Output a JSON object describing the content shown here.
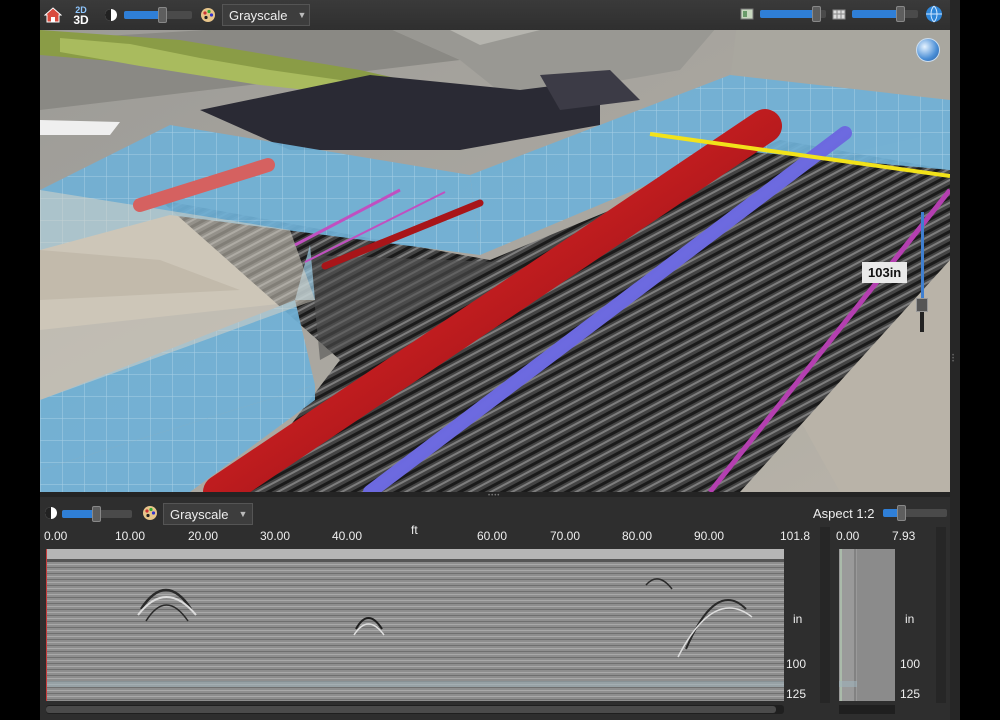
{
  "toolbar": {
    "view_mode_label_top": "2D",
    "view_mode_label_bottom": "3D",
    "colormap": "Grayscale",
    "opacity_value": 0.55
  },
  "view3d": {
    "depth_label": "103in"
  },
  "panel": {
    "colormap": "Grayscale",
    "aspect_label": "Aspect 1:2",
    "x_unit": "ft",
    "x_ticks": [
      "0.00",
      "10.00",
      "20.00",
      "30.00",
      "40.00",
      "60.00",
      "70.00",
      "80.00",
      "90.00",
      "101.8"
    ],
    "depth_unit": "in",
    "depth_ticks": [
      "100",
      "125"
    ],
    "side_x_ticks": [
      "0.00",
      "7.93"
    ],
    "side_depth_unit": "in",
    "side_depth_ticks": [
      "100",
      "125"
    ]
  },
  "colors": {
    "accent": "#2f7fd7",
    "pipe_red": "#b3191c",
    "pipe_blue": "#5a58c8",
    "line_yellow": "#f2e21a",
    "line_magenta": "#b43fb0",
    "wall": "#6fb2d9"
  },
  "icons": [
    "home-icon",
    "2d-3d-toggle-icon",
    "contrast-icon",
    "palette-icon",
    "layers-icon",
    "grid-icon",
    "globe-icon"
  ]
}
